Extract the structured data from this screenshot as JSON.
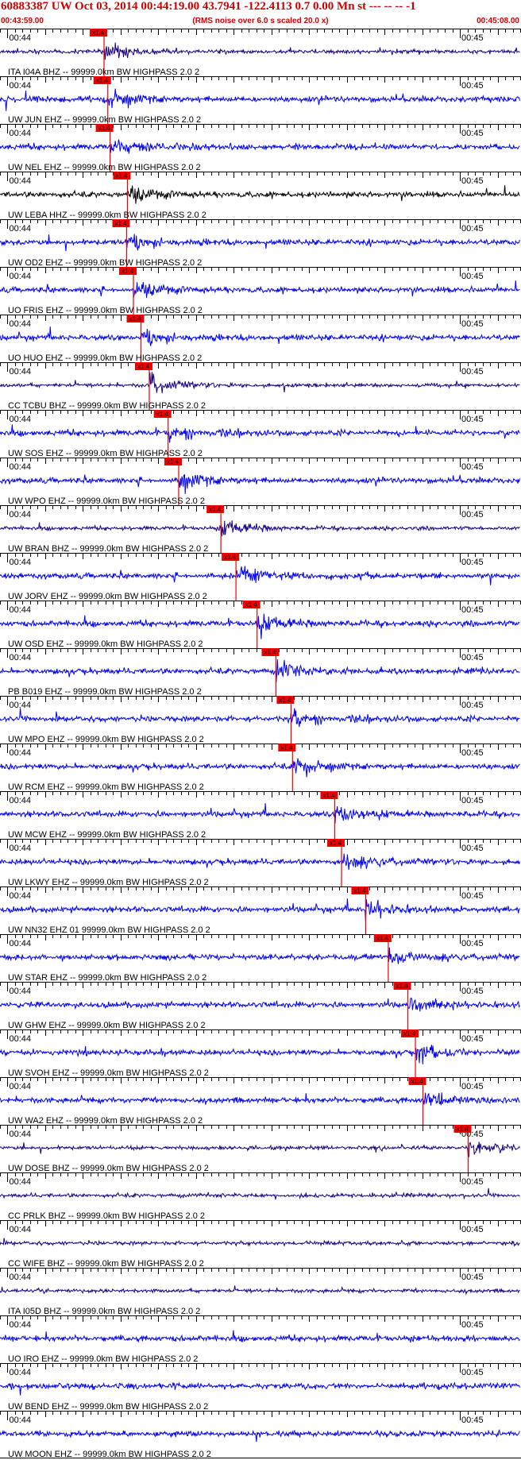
{
  "header": {
    "title": "60883387 UW Oct 03, 2014 00:44:19.00   43.7941 -122.4113  0.7 0.00 Mn st --- -- --   -1",
    "start_time": "00:43:59.00",
    "note": "(RMS noise over 6.0 s scaled 20.0 x)",
    "end_time": "00:45:08.00"
  },
  "chart_data": {
    "type": "line",
    "x_unit": "seconds after 00:43:59.00",
    "xlim": [
      0,
      69
    ],
    "time_tick_labels": [
      {
        "t": 1,
        "label": "00:44"
      },
      {
        "t": 61,
        "label": "00:45"
      }
    ],
    "pick_label": "x1.4",
    "colors": {
      "trace": "#0000ee",
      "broadband": "#1a0080",
      "pick": "#ee0000",
      "grid": "#000000"
    },
    "traces": [
      {
        "label": "ITA I04A BHZ -- 99999.0km BW  HIGHPASS  2.0  2",
        "pick_time": 13.8,
        "kind": "broadband"
      },
      {
        "label": "UW JUN EHZ -- 99999.0km BW  HIGHPASS  2.0  2",
        "pick_time": 14.3,
        "kind": "short"
      },
      {
        "label": "UW NEL EHZ -- 99999.0km BW  HIGHPASS  2.0  2",
        "pick_time": 14.6,
        "kind": "short"
      },
      {
        "label": "UW LEBA HHZ -- 99999.0km BW  HIGHPASS  2.0  2",
        "pick_time": 16.9,
        "kind": "black"
      },
      {
        "label": "UW OD2 EHZ -- 99999.0km BW  HIGHPASS  2.0  2",
        "pick_time": 16.8,
        "kind": "short"
      },
      {
        "label": "UO FRIS EHZ -- 99999.0km BW  HIGHPASS  2.0  2",
        "pick_time": 17.7,
        "kind": "short"
      },
      {
        "label": "UO HUO EHZ -- 99999.0km BW  HIGHPASS  2.0  2",
        "pick_time": 18.7,
        "kind": "short"
      },
      {
        "label": "CC TCBU BHZ -- 99999.0km BW  HIGHPASS  2.0  2",
        "pick_time": 19.8,
        "kind": "broadband"
      },
      {
        "label": "UW SOS EHZ -- 99999.0km BW  HIGHPASS  2.0  2",
        "pick_time": 22.3,
        "kind": "short"
      },
      {
        "label": "UW WPO EHZ -- 99999.0km BW  HIGHPASS  2.0  2",
        "pick_time": 23.7,
        "kind": "short"
      },
      {
        "label": "UW BRAN BHZ -- 99999.0km BW  HIGHPASS  2.0  2",
        "pick_time": 29.3,
        "kind": "broadband"
      },
      {
        "label": "UW JORV EHZ -- 99999.0km BW  HIGHPASS  2.0  2",
        "pick_time": 31.3,
        "kind": "short"
      },
      {
        "label": "UW OSD EHZ -- 99999.0km BW  HIGHPASS  2.0  2",
        "pick_time": 34.1,
        "kind": "short"
      },
      {
        "label": "PB B019 EHZ -- 99999.0km BW  HIGHPASS  2.0  2",
        "pick_time": 36.6,
        "kind": "short"
      },
      {
        "label": "UW MPO EHZ -- 99999.0km BW  HIGHPASS  2.0  2",
        "pick_time": 38.6,
        "kind": "short"
      },
      {
        "label": "UW RCM EHZ -- 99999.0km BW  HIGHPASS  2.0  2",
        "pick_time": 38.8,
        "kind": "short"
      },
      {
        "label": "UW MCW EHZ -- 99999.0km BW  HIGHPASS  2.0  2",
        "pick_time": 44.4,
        "kind": "short"
      },
      {
        "label": "UW LKWY EHZ -- 99999.0km BW  HIGHPASS  2.0  2",
        "pick_time": 45.3,
        "kind": "short"
      },
      {
        "label": "UW NN32 EHZ 01 99999.0km BW  HIGHPASS  2.0  2",
        "pick_time": 48.5,
        "kind": "short"
      },
      {
        "label": "UW STAR EHZ -- 99999.0km BW  HIGHPASS  2.0  2",
        "pick_time": 51.5,
        "kind": "short"
      },
      {
        "label": "UW GHW EHZ -- 99999.0km BW  HIGHPASS  2.0  2",
        "pick_time": 54.1,
        "kind": "short"
      },
      {
        "label": "UW SVOH EHZ -- 99999.0km BW  HIGHPASS  2.0  2",
        "pick_time": 55.1,
        "kind": "short"
      },
      {
        "label": "UW WA2 EHZ -- 99999.0km BW  HIGHPASS  2.0  2",
        "pick_time": 56.1,
        "kind": "short"
      },
      {
        "label": "UW DOSE BHZ -- 99999.0km BW  HIGHPASS  2.0  2",
        "pick_time": 62.1,
        "kind": "broadband"
      },
      {
        "label": "CC PRLK BHZ -- 99999.0km BW  HIGHPASS  2.0  2",
        "pick_time": null,
        "kind": "broadband"
      },
      {
        "label": "CC WIFE BHZ -- 99999.0km BW  HIGHPASS  2.0  2",
        "pick_time": null,
        "kind": "broadband"
      },
      {
        "label": "ITA I05D BHZ -- 99999.0km BW  HIGHPASS  2.0  2",
        "pick_time": null,
        "kind": "broadband"
      },
      {
        "label": "UO IRO EHZ -- 99999.0km BW  HIGHPASS  2.0  2",
        "pick_time": null,
        "kind": "short"
      },
      {
        "label": "UW BEND EHZ -- 99999.0km BW  HIGHPASS  2.0  2",
        "pick_time": null,
        "kind": "short"
      },
      {
        "label": "UW MOON EHZ -- 99999.0km BW  HIGHPASS  2.0  2",
        "pick_time": null,
        "kind": "short"
      }
    ]
  }
}
